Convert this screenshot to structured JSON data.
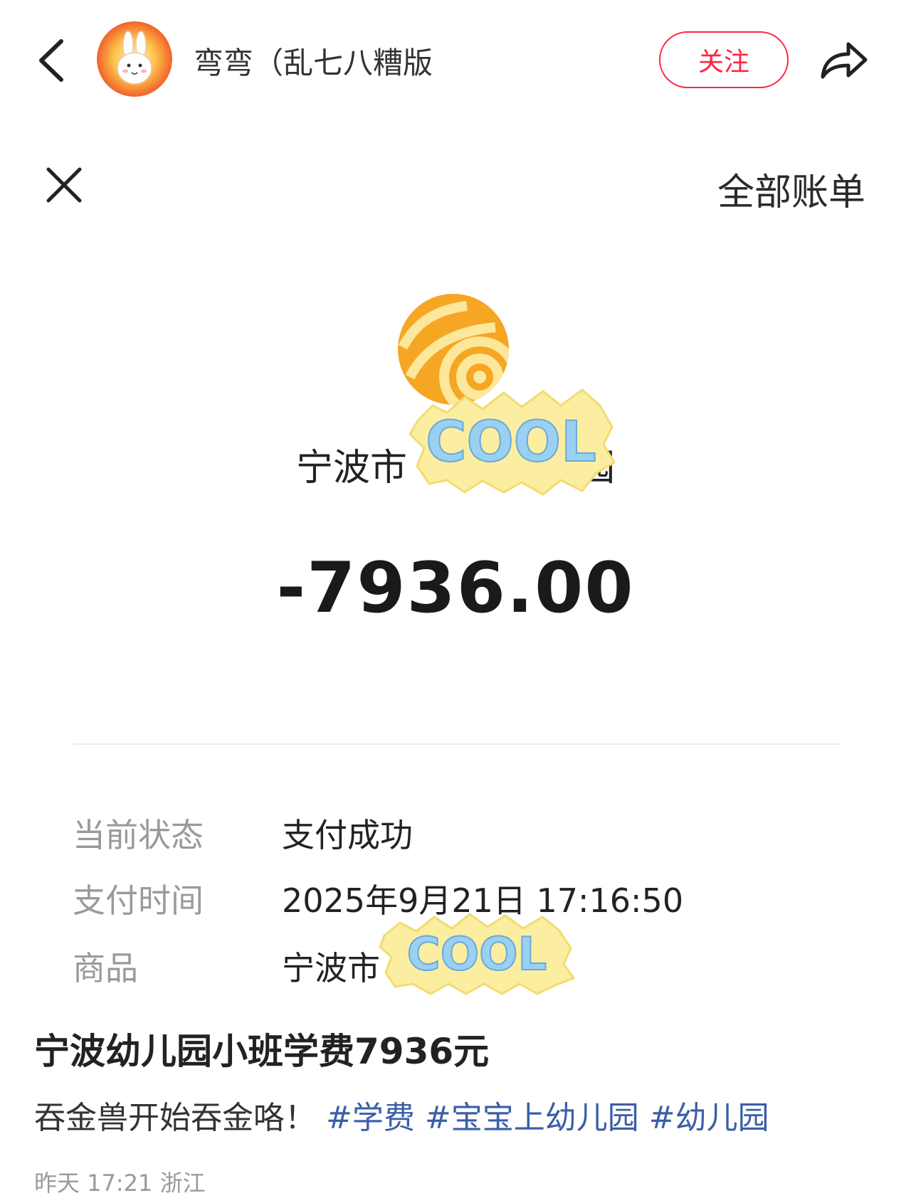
{
  "header": {
    "author_name": "弯弯（乱七八糟版",
    "follow_label": "关注",
    "accent_color": "#ff2442"
  },
  "bill": {
    "all_bills_label": "全部账单",
    "merchant": "宁波市",
    "merchant_suffix": "园",
    "amount": "-7936.00",
    "sticker_text": "COOL",
    "details": [
      {
        "label": "当前状态",
        "value": "支付成功"
      },
      {
        "label": "支付时间",
        "value": "2025年9月21日 17:16:50"
      },
      {
        "label": "商品",
        "value": "宁波市"
      }
    ]
  },
  "post": {
    "title": "宁波幼儿园小班学费7936元",
    "text": "吞金兽开始吞金咯！",
    "tags": [
      "#学费",
      "#宝宝上幼儿园",
      "#幼儿园"
    ],
    "tag_color": "#3b5ea8",
    "meta": "昨天 17:21 浙江"
  },
  "icons": [
    "back-icon",
    "share-icon",
    "close-icon",
    "merchant-logo-icon",
    "cool-sticker"
  ]
}
